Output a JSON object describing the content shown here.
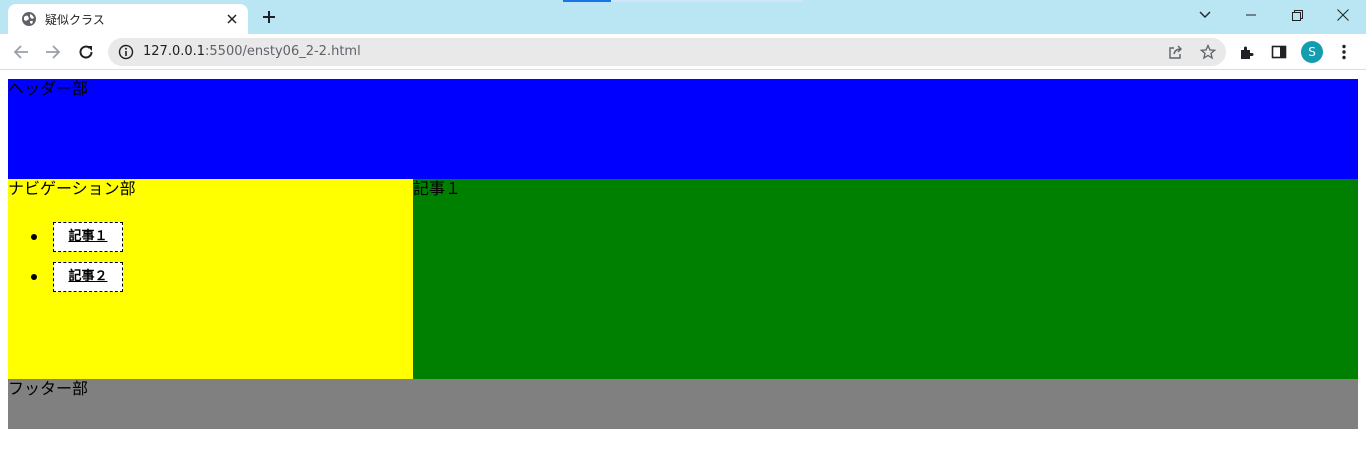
{
  "browser": {
    "tab": {
      "title": "疑似クラス",
      "favicon": "globe-icon",
      "close_icon": "close-icon"
    },
    "new_tab_icon": "plus-icon",
    "window_controls": [
      "chevron-down-icon",
      "minimize-icon",
      "restore-icon",
      "close-icon"
    ],
    "nav_buttons": [
      "back-icon",
      "forward-icon",
      "reload-icon"
    ],
    "address": {
      "host": "127.0.0.1",
      "path": ":5500/ensty06_2-2.html",
      "info_icon": "info-icon"
    },
    "omnibox_actions": [
      "share-icon",
      "star-icon"
    ],
    "toolbar_actions": [
      "extensions-icon",
      "side-panel-icon"
    ],
    "profile_initial": "S",
    "menu_icon": "more-vert-icon",
    "colors": {
      "tabbar": "#b9e6f2",
      "avatar": "#129eaf",
      "accent": "#1a73e8"
    }
  },
  "page": {
    "header_text": "ヘッダー部",
    "nav_text": "ナビゲーション部",
    "nav_links": [
      "記事１",
      "記事２"
    ],
    "article_text": "記事１",
    "footer_text": "フッター部",
    "colors": {
      "header": "#0000ff",
      "nav": "#ffff00",
      "article": "#008000",
      "footer": "#808080"
    }
  }
}
